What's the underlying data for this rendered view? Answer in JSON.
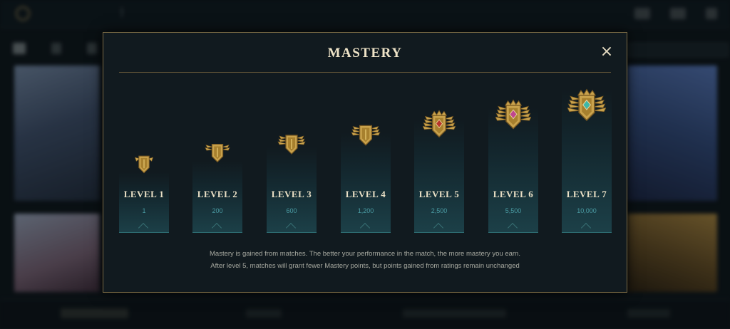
{
  "modal": {
    "title": "MASTERY",
    "close_glyph": "×",
    "levels": [
      {
        "label": "LEVEL 1",
        "points": "1"
      },
      {
        "label": "LEVEL 2",
        "points": "200"
      },
      {
        "label": "LEVEL 3",
        "points": "600"
      },
      {
        "label": "LEVEL 4",
        "points": "1,200"
      },
      {
        "label": "LEVEL 5",
        "points": "2,500"
      },
      {
        "label": "LEVEL 6",
        "points": "5,500"
      },
      {
        "label": "LEVEL 7",
        "points": "10,000"
      }
    ],
    "note_line1": "Mastery is gained from matches. The better your performance in the match, the more mastery you earn.",
    "note_line2": "After level 5, matches will grant fewer Mastery points, but points gained from ratings remain unchanged"
  },
  "colors": {
    "gold": "#c9a24c",
    "gold_dark": "#7a5a22",
    "teal_gem": "#3fb8a8",
    "pink_gem": "#c0458e",
    "red_gem": "#b8352a"
  }
}
